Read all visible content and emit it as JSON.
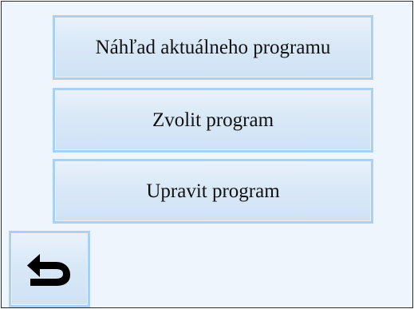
{
  "menu": {
    "items": [
      {
        "label": "Náhľad aktuálneho programu"
      },
      {
        "label": "Zvolit program"
      },
      {
        "label": "Upravit program"
      }
    ]
  },
  "back_button": {
    "icon": "return-arrow-icon"
  },
  "colors": {
    "screen_background": "#eef5fc",
    "button_border": "#a9d0f5",
    "button_fill": "#d9e8f7",
    "text": "#111111",
    "frame": "#2b2b2b"
  }
}
